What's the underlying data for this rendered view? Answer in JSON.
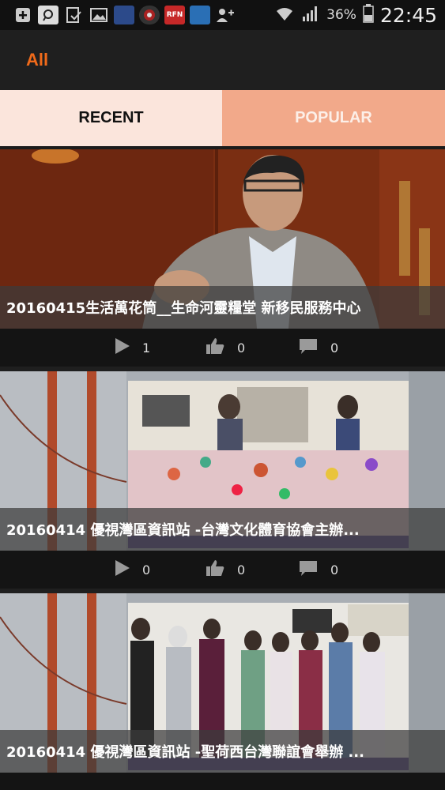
{
  "status_bar": {
    "battery_percent": "36%",
    "time": "22:45",
    "icons": [
      "plus-box-icon",
      "search-app-icon",
      "check-doc-icon",
      "image-icon",
      "news-app-icon",
      "badge-app-icon",
      "rfn-app-icon",
      "news2-app-icon",
      "add-user-icon",
      "wifi-icon",
      "signal-icon",
      "battery-icon"
    ],
    "rfn_label": "RFN"
  },
  "app_bar": {
    "title": "All"
  },
  "tabs": [
    {
      "label": "RECENT",
      "selected": true
    },
    {
      "label": "POPULAR",
      "selected": false
    }
  ],
  "items": [
    {
      "title": "20160415生活萬花筒__生命河靈糧堂 新移民服務中心",
      "plays": "1",
      "likes": "0",
      "comments": "0"
    },
    {
      "title": "20160414 優視灣區資訊站 -台灣文化體育協會主辦...",
      "plays": "0",
      "likes": "0",
      "comments": "0"
    },
    {
      "title": "20160414 優視灣區資訊站 -聖荷西台灣聯誼會舉辦 ...",
      "plays": "",
      "likes": "",
      "comments": ""
    }
  ],
  "colors": {
    "accent": "#f06a1a",
    "tab_selected": "#fbe5dc",
    "tab_unselected": "#f2a98a"
  }
}
